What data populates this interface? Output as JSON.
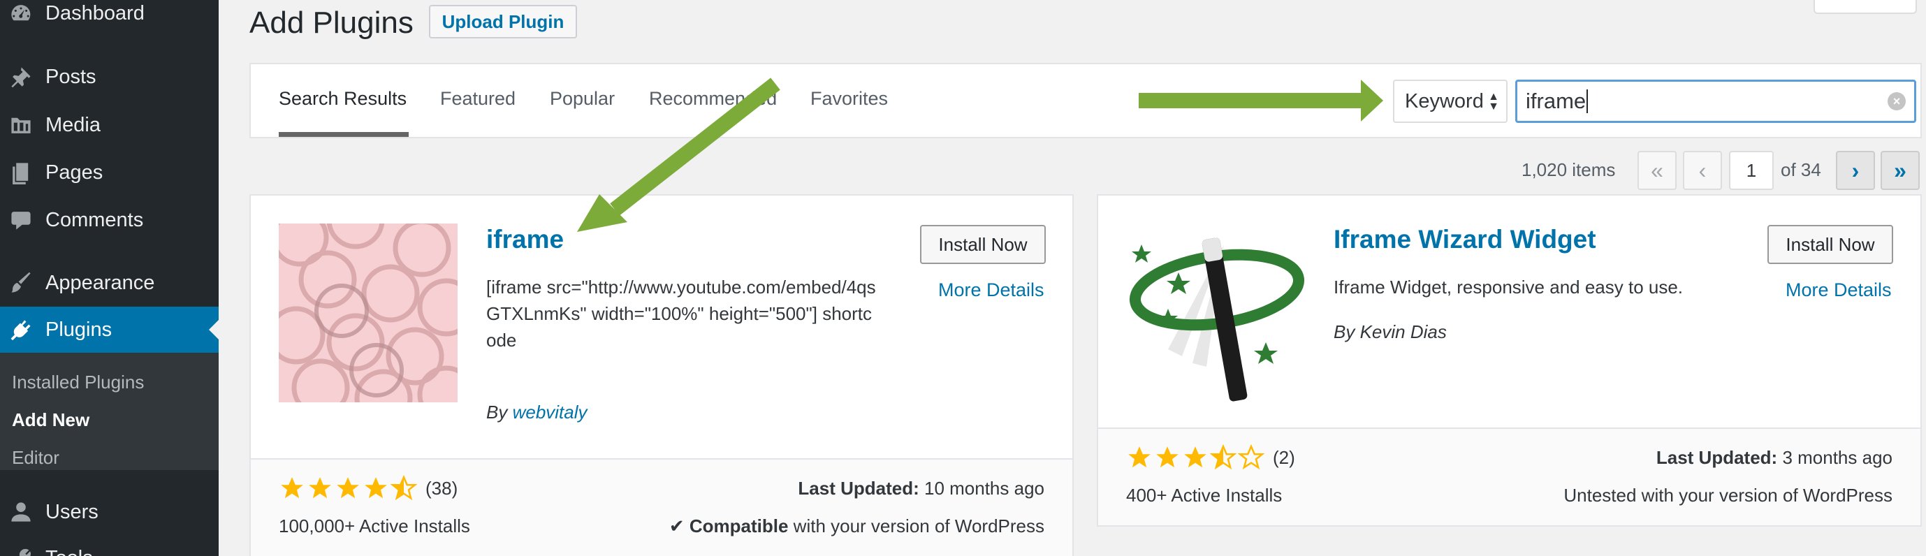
{
  "sidebar": {
    "items": [
      {
        "label": "Dashboard",
        "icon": "dashboard-icon"
      },
      {
        "label": "Posts",
        "icon": "pushpin-icon"
      },
      {
        "label": "Media",
        "icon": "media-icon"
      },
      {
        "label": "Pages",
        "icon": "pages-icon"
      },
      {
        "label": "Comments",
        "icon": "comment-icon"
      },
      {
        "label": "Appearance",
        "icon": "paintbrush-icon"
      },
      {
        "label": "Plugins",
        "icon": "plugin-icon"
      },
      {
        "label": "Users",
        "icon": "user-icon"
      },
      {
        "label": "Tools",
        "icon": "wrench-icon"
      }
    ],
    "submenu": [
      "Installed Plugins",
      "Add New",
      "Editor"
    ],
    "current_item": "Plugins",
    "current_sub": "Add New"
  },
  "header": {
    "title": "Add Plugins",
    "upload_label": "Upload Plugin"
  },
  "filter": {
    "tabs": [
      "Search Results",
      "Featured",
      "Popular",
      "Recommended",
      "Favorites"
    ],
    "current_tab": "Search Results",
    "search_type": "Keyword",
    "search_value": "iframe"
  },
  "pagination": {
    "items_count": "1,020 items",
    "first": "«",
    "prev": "‹",
    "current_page": "1",
    "of_total": "of 34",
    "next": "›",
    "last": "»"
  },
  "plugins": [
    {
      "name": "iframe",
      "description": "[iframe src=\"http://www.youtube.com/embed/4qsGTXLnmKs\" width=\"100%\" height=\"500\"] shortcode",
      "author_prefix": "By",
      "author": "webvitaly",
      "install_label": "Install Now",
      "more_details_label": "More Details",
      "rating": 4.5,
      "rating_count": "(38)",
      "active_installs": "100,000+ Active Installs",
      "last_updated_label": "Last Updated:",
      "last_updated": "10 months ago",
      "compat_bold": "Compatible",
      "compat_rest": "with your version of WordPress"
    },
    {
      "name": "Iframe Wizard Widget",
      "description": "Iframe Widget, responsive and easy to use.",
      "author_prefix": "By",
      "author": "Kevin Dias",
      "install_label": "Install Now",
      "more_details_label": "More Details",
      "rating": 3.5,
      "rating_count": "(2)",
      "active_installs": "400+ Active Installs",
      "last_updated_label": "Last Updated:",
      "last_updated": "3 months ago",
      "compat_text": "Untested with your version of WordPress"
    }
  ],
  "colors": {
    "sidebar_bg": "#23282d",
    "accent": "#0073aa",
    "annotation_arrow": "#7cab3a",
    "star": "#ffb900"
  }
}
